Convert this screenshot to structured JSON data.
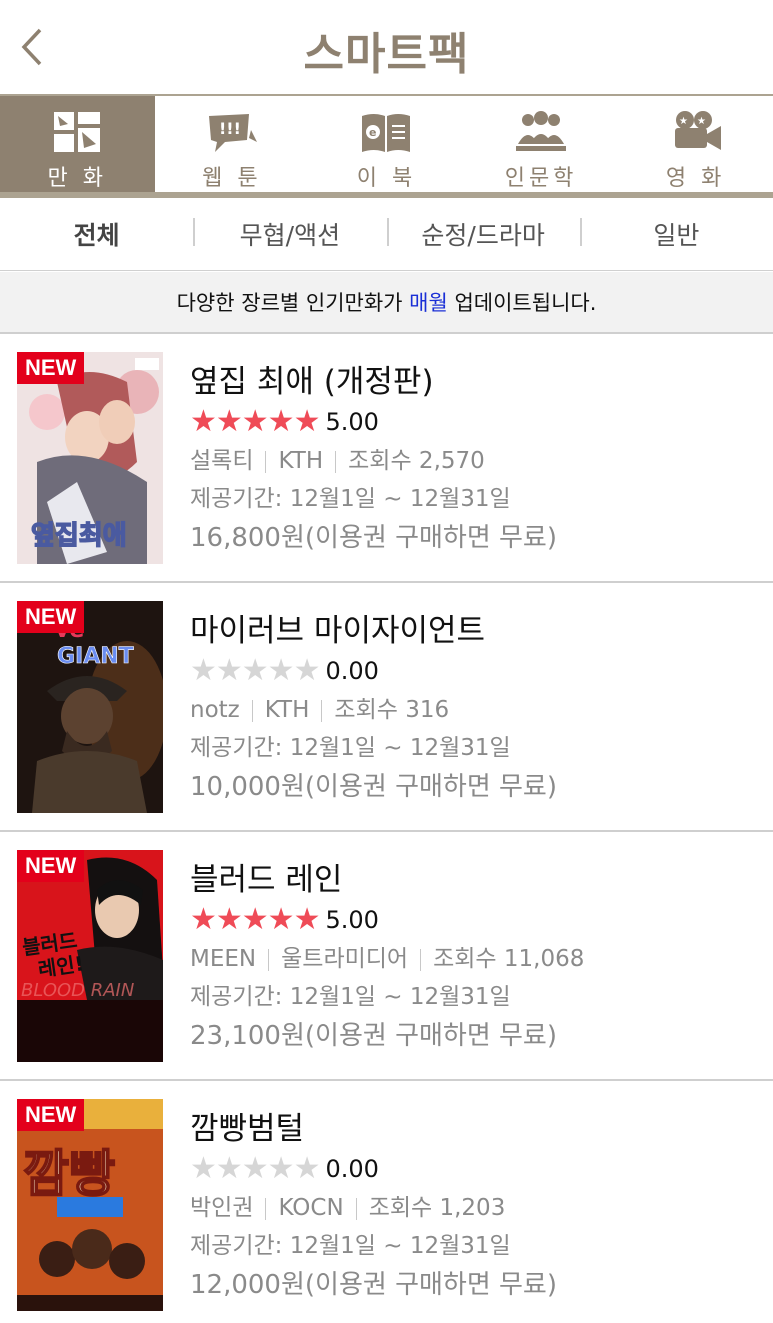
{
  "header": {
    "title": "스마트팩"
  },
  "categories": [
    {
      "label": "만 화",
      "icon": "comic-icon",
      "active": true
    },
    {
      "label": "웹 툰",
      "icon": "webtoon-icon",
      "active": false
    },
    {
      "label": "이 북",
      "icon": "ebook-icon",
      "active": false
    },
    {
      "label": "인문학",
      "icon": "humanities-icon",
      "active": false
    },
    {
      "label": "영 화",
      "icon": "movie-camera-icon",
      "active": false
    }
  ],
  "genres": [
    "전체",
    "무협/액션",
    "순정/드라마",
    "일반"
  ],
  "notice": {
    "before": "다양한 장르별 인기만화가 ",
    "highlight": "매월",
    "after": " 업데이트됩니다."
  },
  "badge_label": "NEW",
  "items": [
    {
      "title": "옆집 최애 (개정판)",
      "stars": "★★★★★",
      "rating": "5.00",
      "rated": true,
      "author": "설록티",
      "publisher": "KTH",
      "views": "조회수 2,570",
      "period": "제공기간: 12월1일 ~ 12월31일",
      "price": "16,800원(이용권 구매하면 무료)",
      "cover_text": "옆집최애"
    },
    {
      "title": "마이러브 마이자이언트",
      "stars": "★★★★★",
      "rating": "0.00",
      "rated": false,
      "author": "notz",
      "publisher": "KTH",
      "views": "조회수 316",
      "period": "제공기간: 12월1일 ~ 12월31일",
      "price": "10,000원(이용권 구매하면 무료)",
      "cover_text": "GIANT"
    },
    {
      "title": "블러드 레인",
      "stars": "★★★★★",
      "rating": "5.00",
      "rated": true,
      "author": "MEEN",
      "publisher": "울트라미디어",
      "views": "조회수 11,068",
      "period": "제공기간: 12월1일 ~ 12월31일",
      "price": "23,100원(이용권 구매하면 무료)",
      "cover_text": "BLOOD RAIN"
    },
    {
      "title": "깜빵범털",
      "stars": "★★★★★",
      "rating": "0.00",
      "rated": false,
      "author": "박인권",
      "publisher": "KOCN",
      "views": "조회수 1,203",
      "period": "제공기간: 12월1일 ~ 12월31일",
      "price": "12,000원(이용권 구매하면 무료)",
      "cover_text": "깜빵"
    }
  ]
}
